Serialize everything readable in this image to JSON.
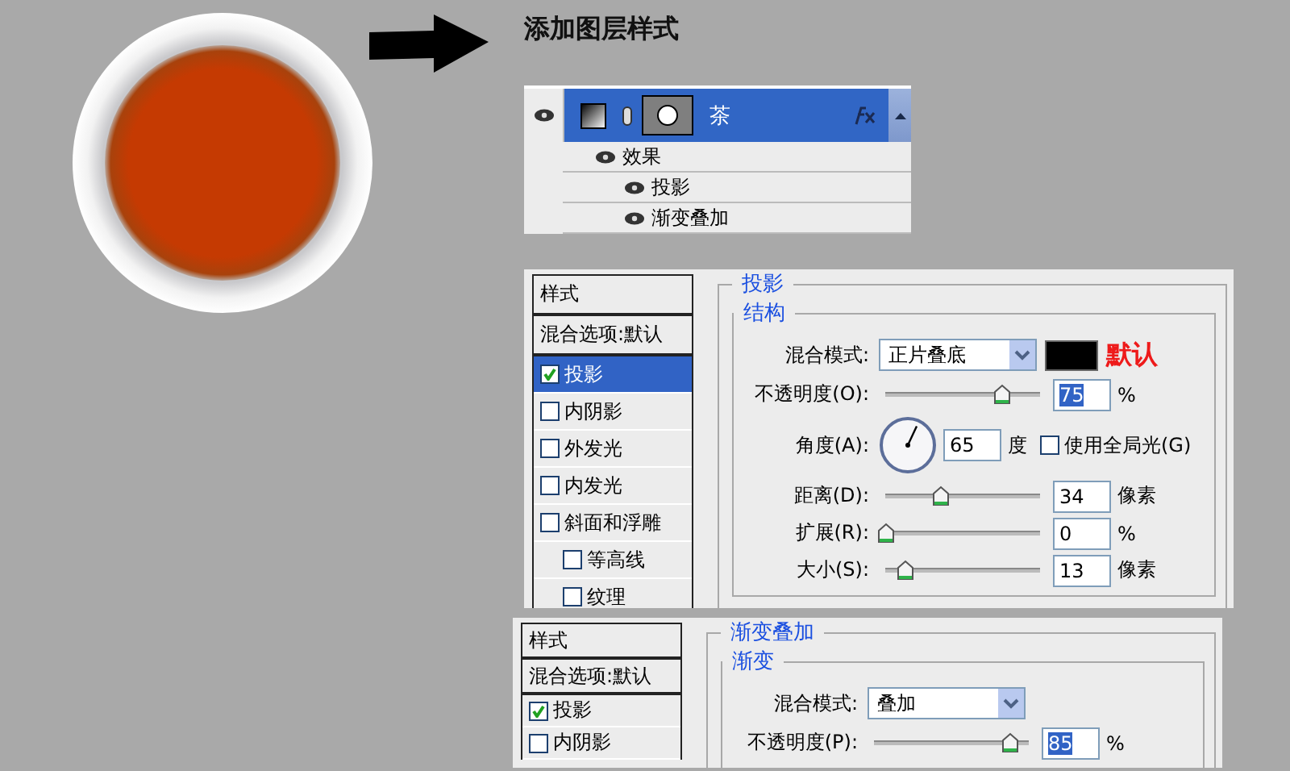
{
  "title": "添加图层样式",
  "layers_panel": {
    "layer": {
      "name": "茶",
      "selected": true,
      "visible": true,
      "has_effects": true
    },
    "effects_label": "效果",
    "effects_visible": true,
    "effects": [
      {
        "name": "投影",
        "visible": true
      },
      {
        "name": "渐变叠加",
        "visible": true
      }
    ]
  },
  "dialogs": [
    {
      "styles": [
        {
          "kind": "header",
          "label": "样式"
        },
        {
          "kind": "header",
          "label": "混合选项:默认"
        },
        {
          "kind": "check",
          "label": "投影",
          "checked": true,
          "selected": true
        },
        {
          "kind": "check",
          "label": "内阴影",
          "checked": false,
          "selected": false
        },
        {
          "kind": "check",
          "label": "外发光",
          "checked": false,
          "selected": false
        },
        {
          "kind": "check",
          "label": "内发光",
          "checked": false,
          "selected": false
        },
        {
          "kind": "check",
          "label": "斜面和浮雕",
          "checked": false,
          "selected": false,
          "children": [
            {
              "kind": "check",
              "label": "等高线",
              "checked": false,
              "selected": false
            },
            {
              "kind": "check",
              "label": "纹理",
              "checked": false,
              "selected": false
            }
          ]
        }
      ],
      "section": "投影",
      "group": "结构",
      "rows": [
        {
          "kind": "select",
          "label": "混合模式:",
          "value": "正片叠底",
          "has_swatch": true,
          "note": "默认"
        },
        {
          "kind": "slider",
          "label": "不透明度(O):",
          "level": 0.75,
          "value": "75",
          "value_selected": true,
          "unit": "%"
        },
        {
          "kind": "angle",
          "label": "角度(A):",
          "value": "65",
          "unit": "度",
          "option": {
            "label": "使用全局光(G)",
            "checked": false
          }
        },
        {
          "kind": "slider",
          "label": "距离(D):",
          "level": 0.35,
          "value": "34",
          "value_selected": false,
          "unit": "像素"
        },
        {
          "kind": "slider",
          "label": "扩展(R):",
          "level": 0,
          "value": "0",
          "value_selected": false,
          "unit": "%"
        },
        {
          "kind": "slider",
          "label": "大小(S):",
          "level": 0.13,
          "value": "13",
          "value_selected": false,
          "unit": "像素"
        }
      ]
    },
    {
      "styles": [
        {
          "kind": "header",
          "label": "样式"
        },
        {
          "kind": "header",
          "label": "混合选项:默认"
        },
        {
          "kind": "check",
          "label": "投影",
          "checked": true,
          "selected": false
        },
        {
          "kind": "check",
          "label": "内阴影",
          "checked": false,
          "selected": false
        }
      ],
      "section": "渐变叠加",
      "group": "渐变",
      "rows": [
        {
          "kind": "select",
          "label": "混合模式:",
          "value": "叠加"
        },
        {
          "kind": "slider",
          "label": "不透明度(P):",
          "level": 0.88,
          "value": "85",
          "value_selected": true,
          "unit": "%"
        }
      ]
    }
  ]
}
